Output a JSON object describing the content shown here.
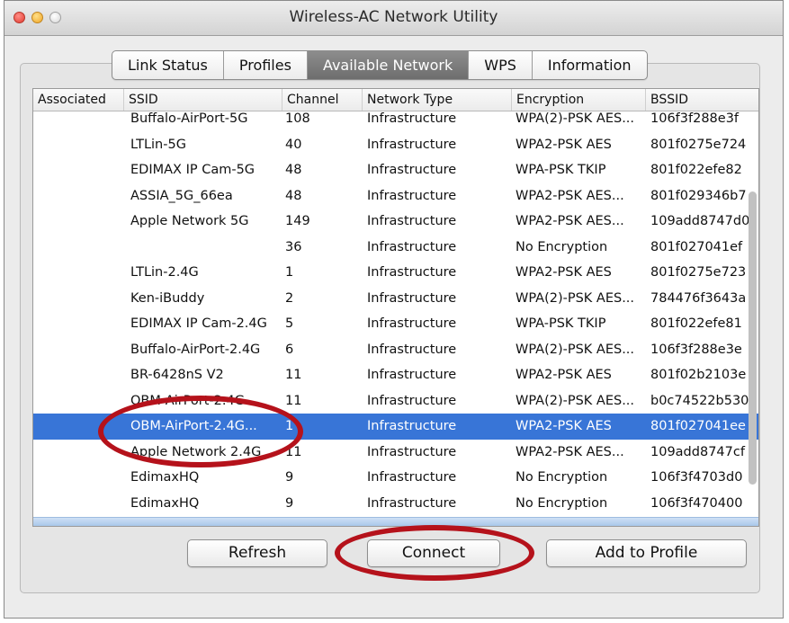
{
  "window": {
    "title": "Wireless-AC Network Utility"
  },
  "tabs": [
    {
      "label": "Link Status",
      "active": false
    },
    {
      "label": "Profiles",
      "active": false
    },
    {
      "label": "Available Network",
      "active": true
    },
    {
      "label": "WPS",
      "active": false
    },
    {
      "label": "Information",
      "active": false
    }
  ],
  "table": {
    "columns": [
      "Associated",
      "SSID",
      "Channel",
      "Network Type",
      "Encryption",
      "BSSID"
    ],
    "rows": [
      {
        "associated": "",
        "ssid": "Buffalo-AirPort-5G",
        "channel": "108",
        "network_type": "Infrastructure",
        "encryption": "WPA(2)-PSK AES...",
        "bssid": "106f3f288e3f"
      },
      {
        "associated": "",
        "ssid": "LTLin-5G",
        "channel": "40",
        "network_type": "Infrastructure",
        "encryption": "WPA2-PSK AES",
        "bssid": "801f0275e724"
      },
      {
        "associated": "",
        "ssid": "EDIMAX IP Cam-5G",
        "channel": "48",
        "network_type": "Infrastructure",
        "encryption": "WPA-PSK TKIP",
        "bssid": "801f022efe82"
      },
      {
        "associated": "",
        "ssid": "ASSIA_5G_66ea",
        "channel": "48",
        "network_type": "Infrastructure",
        "encryption": "WPA2-PSK AES...",
        "bssid": "801f029346b7"
      },
      {
        "associated": "",
        "ssid": "Apple Network 5G",
        "channel": "149",
        "network_type": "Infrastructure",
        "encryption": "WPA2-PSK AES...",
        "bssid": "109add8747d0"
      },
      {
        "associated": "",
        "ssid": "",
        "channel": "36",
        "network_type": "Infrastructure",
        "encryption": "No Encryption",
        "bssid": "801f027041ef"
      },
      {
        "associated": "",
        "ssid": "LTLin-2.4G",
        "channel": "1",
        "network_type": "Infrastructure",
        "encryption": "WPA2-PSK AES",
        "bssid": "801f0275e723"
      },
      {
        "associated": "",
        "ssid": "Ken-iBuddy",
        "channel": "2",
        "network_type": "Infrastructure",
        "encryption": "WPA(2)-PSK AES...",
        "bssid": "784476f3643a"
      },
      {
        "associated": "",
        "ssid": "EDIMAX IP Cam-2.4G",
        "channel": "5",
        "network_type": "Infrastructure",
        "encryption": "WPA-PSK TKIP",
        "bssid": "801f022efe81"
      },
      {
        "associated": "",
        "ssid": "Buffalo-AirPort-2.4G",
        "channel": "6",
        "network_type": "Infrastructure",
        "encryption": "WPA(2)-PSK AES...",
        "bssid": "106f3f288e3e"
      },
      {
        "associated": "",
        "ssid": "BR-6428nS V2",
        "channel": "11",
        "network_type": "Infrastructure",
        "encryption": "WPA2-PSK AES",
        "bssid": "801f02b2103e"
      },
      {
        "associated": "",
        "ssid": "OBM-AirPort-2.4G",
        "channel": "11",
        "network_type": "Infrastructure",
        "encryption": "WPA(2)-PSK AES...",
        "bssid": "b0c74522b530"
      },
      {
        "associated": "",
        "ssid": "OBM-AirPort-2.4G...",
        "channel": "1",
        "network_type": "Infrastructure",
        "encryption": "WPA2-PSK AES",
        "bssid": "801f027041ee",
        "selected": true
      },
      {
        "associated": "",
        "ssid": "Apple Network 2.4G",
        "channel": "11",
        "network_type": "Infrastructure",
        "encryption": "WPA2-PSK AES...",
        "bssid": "109add8747cf"
      },
      {
        "associated": "",
        "ssid": "EdimaxHQ",
        "channel": "9",
        "network_type": "Infrastructure",
        "encryption": "No Encryption",
        "bssid": "106f3f4703d0"
      },
      {
        "associated": "",
        "ssid": "EdimaxHQ",
        "channel": "9",
        "network_type": "Infrastructure",
        "encryption": "No Encryption",
        "bssid": "106f3f470400"
      }
    ]
  },
  "buttons": {
    "refresh": "Refresh",
    "connect": "Connect",
    "add_to_profile": "Add to Profile"
  },
  "colors": {
    "selection": "#3875d7",
    "annotation": "#b5121b"
  }
}
